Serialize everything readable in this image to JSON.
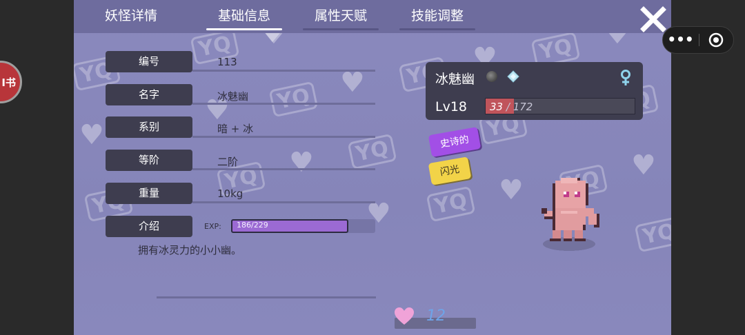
{
  "side_stub": {
    "text": "I书"
  },
  "tabs": [
    {
      "label": "妖怪详情",
      "active": false
    },
    {
      "label": "基础信息",
      "active": true
    },
    {
      "label": "属性天赋",
      "active": false
    },
    {
      "label": "技能调整",
      "active": false
    }
  ],
  "info": {
    "rows": [
      {
        "label": "编号",
        "value": "113"
      },
      {
        "label": "名字",
        "value": "冰魅幽"
      },
      {
        "label": "系别",
        "value": "暗 + 冰"
      },
      {
        "label": "等阶",
        "value": "二阶"
      },
      {
        "label": "重量",
        "value": "10kg"
      },
      {
        "label": "介绍",
        "value": ""
      }
    ],
    "exp": {
      "label": "EXP:",
      "current": 186,
      "max": 229,
      "text": "186/229"
    },
    "description": "拥有冰灵力的小小幽。"
  },
  "monster": {
    "name": "冰魅幽",
    "element_icons": [
      "dark-orb-icon",
      "ice-diamond-icon"
    ],
    "gender_icon": "female-icon",
    "level": "Lv18",
    "hp": {
      "current": 33,
      "max": 172,
      "current_text": "33",
      "max_text": "/ 172"
    }
  },
  "tags": {
    "rarity": "史诗的",
    "shiny": "闪光"
  },
  "hearts": {
    "icon": "heart-icon",
    "count": "12"
  },
  "watermark": {
    "text": "YQ"
  },
  "colors": {
    "background": "#8685b9",
    "header": "#6e6c9e",
    "panel": "#3e3d4f",
    "exp_fill": "#9b6ad3",
    "hp_fill": "#c0545b",
    "rarity_tag": "#a24fe6",
    "shiny_tag": "#f2d348",
    "heart": "#f0a3d8",
    "heart_count": "#6ea4e8"
  }
}
